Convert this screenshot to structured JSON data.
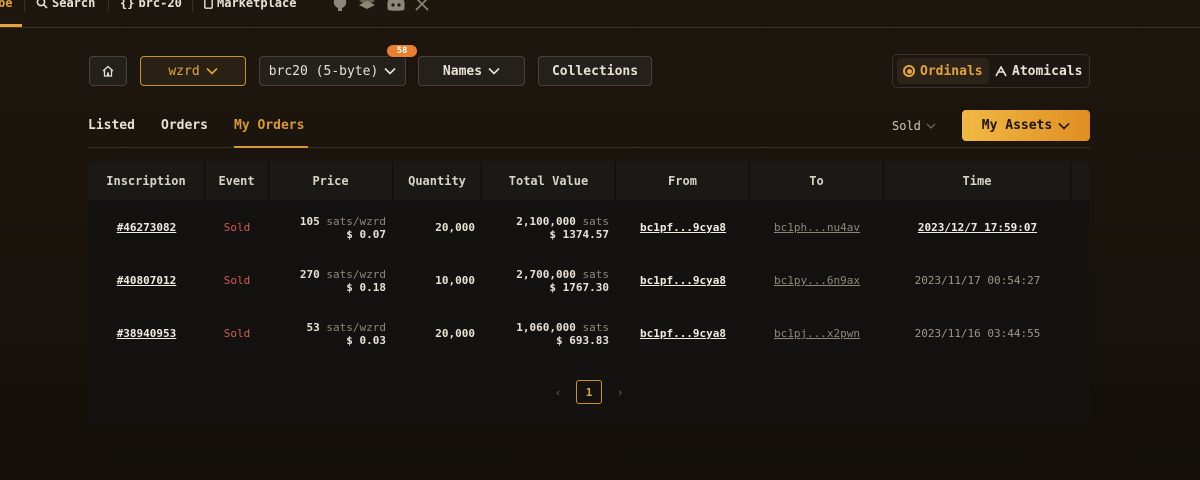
{
  "nav": {
    "first_fragment": "be",
    "search": "Search",
    "brc20": "brc-20",
    "marketplace": "Marketplace"
  },
  "filters": {
    "ticker": "wzrd",
    "standard": "brc20 (5-byte)",
    "standard_badge": "58",
    "names": "Names",
    "collections": "Collections"
  },
  "protocols": {
    "ordinals": "Ordinals",
    "atomicals": "Atomicals"
  },
  "tabs": {
    "listed": "Listed",
    "orders": "Orders",
    "my_orders": "My Orders"
  },
  "status_filter": "Sold",
  "my_assets": "My Assets",
  "table": {
    "headers": [
      "Inscription",
      "Event",
      "Price",
      "Quantity",
      "Total Value",
      "From",
      "To",
      "Time"
    ],
    "rows": [
      {
        "inscription": "#46273082",
        "event": "Sold",
        "price_sats": "105",
        "price_unit": "sats/wzrd",
        "price_usd": "$ 0.07",
        "quantity": "20,000",
        "total_sats": "2,100,000",
        "total_unit": "sats",
        "total_usd": "$ 1374.57",
        "from": "bc1pf...9cya8",
        "to": "bc1ph...nu4av",
        "time": "2023/12/7 17:59:07"
      },
      {
        "inscription": "#40807012",
        "event": "Sold",
        "price_sats": "270",
        "price_unit": "sats/wzrd",
        "price_usd": "$ 0.18",
        "quantity": "10,000",
        "total_sats": "2,700,000",
        "total_unit": "sats",
        "total_usd": "$ 1767.30",
        "from": "bc1pf...9cya8",
        "to": "bc1py...6n9ax",
        "time": "2023/11/17 00:54:27"
      },
      {
        "inscription": "#38940953",
        "event": "Sold",
        "price_sats": "53",
        "price_unit": "sats/wzrd",
        "price_usd": "$ 0.03",
        "quantity": "20,000",
        "total_sats": "1,060,000",
        "total_unit": "sats",
        "total_usd": "$ 693.83",
        "from": "bc1pf...9cya8",
        "to": "bc1pj...x2pwn",
        "time": "2023/11/16 03:44:55"
      }
    ]
  },
  "pagination": {
    "current": "1",
    "prev": "‹",
    "next": "›"
  },
  "colors": {
    "accent": "#e4a43b",
    "sold": "#d45a4d",
    "badge": "#e8802e"
  }
}
